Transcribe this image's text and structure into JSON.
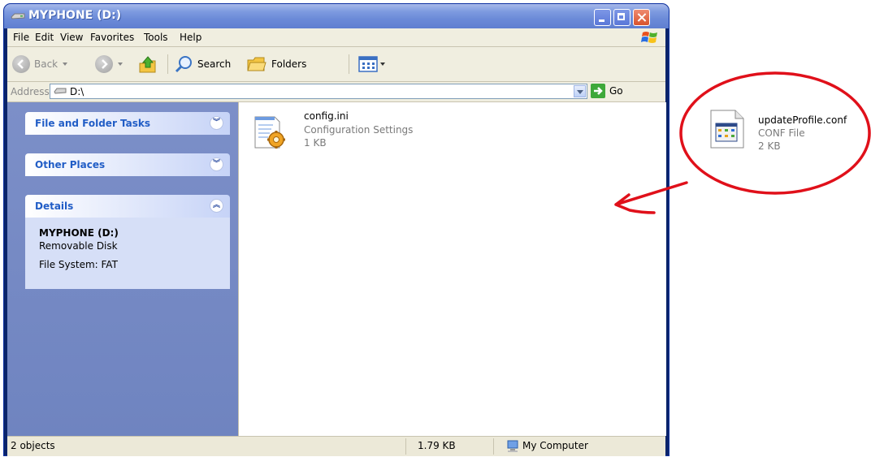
{
  "window": {
    "title": "MYPHONE (D:)"
  },
  "menu": [
    "File",
    "Edit",
    "View",
    "Favorites",
    "Tools",
    "Help"
  ],
  "toolbar": {
    "back_label": "Back",
    "search_label": "Search",
    "folders_label": "Folders"
  },
  "address": {
    "label": "Address",
    "value": "D:\\",
    "go_label": "Go"
  },
  "taskpane": {
    "file_folder_tasks": "File and Folder Tasks",
    "other_places": "Other Places",
    "details": "Details",
    "details_name": "MYPHONE (D:)",
    "details_type": "Removable Disk",
    "details_fs": "File System: FAT"
  },
  "files": [
    {
      "name": "config.ini",
      "type": "Configuration Settings",
      "size": "1 KB",
      "icon": "settings-file-icon"
    }
  ],
  "status": {
    "objects": "2 objects",
    "size": "1.79 KB",
    "location": "My Computer"
  },
  "annotation": {
    "name": "updateProfile.conf",
    "type": "CONF File",
    "size": "2 KB",
    "icon": "conf-file-icon",
    "circle_color": "#e0101a"
  }
}
